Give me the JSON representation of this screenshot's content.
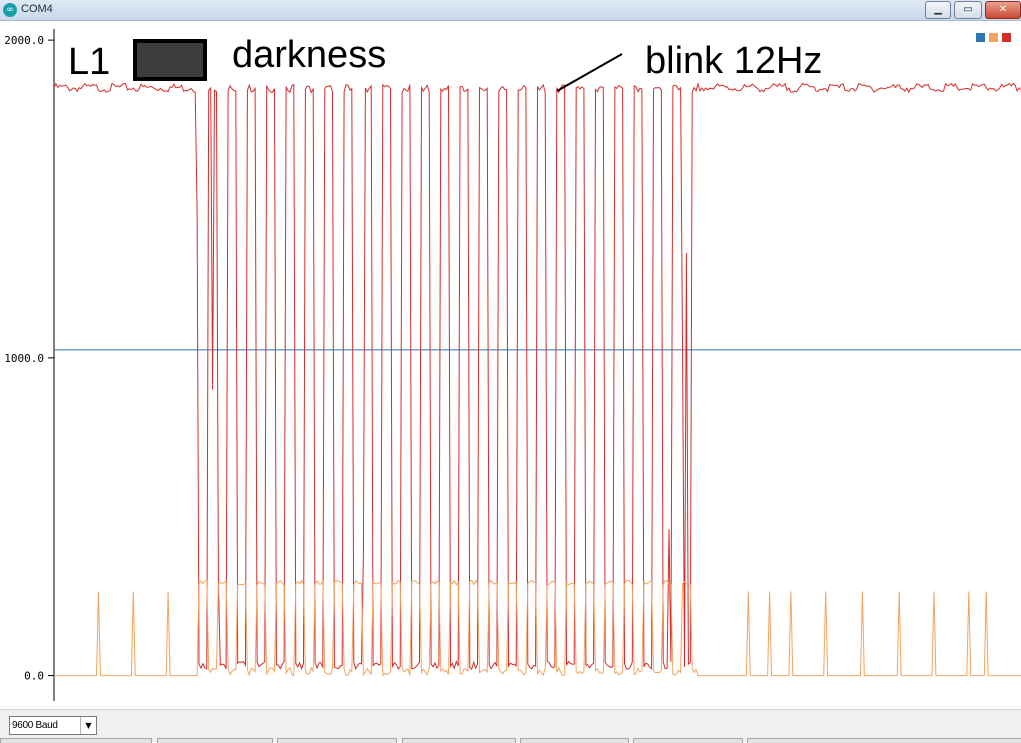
{
  "window": {
    "title": "COM4",
    "app_icon": "arduino-infinity-icon",
    "buttons": [
      "minimize-icon",
      "maximize-icon",
      "close-icon"
    ]
  },
  "annotations": {
    "left_label": "L1",
    "middle_label": "darkness",
    "right_label": "blink 12Hz"
  },
  "legend": [
    {
      "name": "",
      "color": "#2e75b6"
    },
    {
      "name": "",
      "color": "#f4a460"
    },
    {
      "name": "",
      "color": "#d42b2b"
    }
  ],
  "baud": {
    "selected": "9600 Baud"
  },
  "colors": {
    "series1": "#2e75b6",
    "series2": "#f4a460",
    "series3": "#d42b2b",
    "swatch_fill": "#3c3c3c"
  },
  "chart_data": {
    "type": "line",
    "ylim": [
      -80,
      2035
    ],
    "xlim": [
      0,
      500
    ],
    "y_ticks": [
      {
        "value": 0,
        "label": "0.0"
      },
      {
        "value": 1000,
        "label": "1000.0"
      },
      {
        "value": 2000,
        "label": "2000.0"
      }
    ],
    "series": [
      {
        "color": "#2e75b6",
        "type": "constant",
        "value": 1025
      },
      {
        "color": "#d42b2b",
        "type": "blink",
        "baseline": 1850,
        "blink_start": 70,
        "blink_end": 332,
        "low": 20,
        "high": 1860,
        "half_period": 5,
        "anomalies": [
          [
            74,
            1460
          ],
          [
            82,
            900
          ],
          [
            85,
            290
          ],
          [
            160,
            380
          ],
          [
            318,
            460
          ],
          [
            325,
            1000
          ],
          [
            327,
            1330
          ]
        ]
      },
      {
        "color": "#f4a460",
        "type": "blink",
        "baseline": 0,
        "blink_start": 75,
        "blink_end": 332,
        "low": 0,
        "high": 300,
        "half_period": 5,
        "spikes_x": [
          23,
          41,
          59,
          359,
          370,
          381,
          399,
          418,
          437,
          455,
          473,
          482
        ],
        "spike_height": 265
      }
    ]
  }
}
